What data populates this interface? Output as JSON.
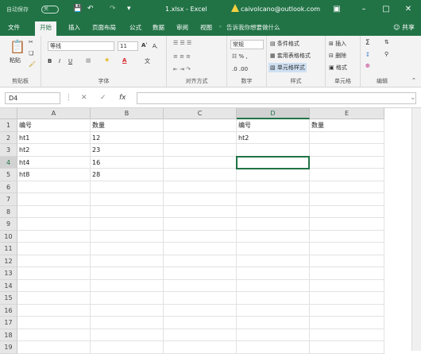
{
  "titlebar": {
    "autosave": "自动保存",
    "toggle": "关",
    "filename": "1.xlsx - Excel",
    "account": "caivolcano@outlook.com"
  },
  "tabs": [
    "文件",
    "开始",
    "插入",
    "页面布局",
    "公式",
    "数据",
    "审阅",
    "视图"
  ],
  "tellme": "告诉我你想要做什么",
  "share": "共享",
  "ribbon": {
    "clipboard": {
      "paste": "粘贴",
      "label": "剪贴板"
    },
    "font": {
      "name": "等线",
      "size": "11",
      "label": "字体"
    },
    "alignment": {
      "label": "对齐方式"
    },
    "number": {
      "format": "常规",
      "label": "数字"
    },
    "styles": {
      "conditional": "条件格式",
      "table": "套用表格格式",
      "cell": "单元格样式",
      "label": "样式"
    },
    "cells": {
      "insert": "插入",
      "delete": "删除",
      "format": "格式",
      "label": "单元格"
    },
    "editing": {
      "label": "编辑"
    }
  },
  "formula": {
    "namebox": "D4",
    "fx": "fx"
  },
  "columns": [
    "A",
    "B",
    "C",
    "D",
    "E"
  ],
  "rows": [
    "1",
    "2",
    "3",
    "4",
    "5",
    "6",
    "7",
    "8",
    "9",
    "10",
    "11",
    "12",
    "13",
    "14",
    "15",
    "16",
    "17",
    "18",
    "19"
  ],
  "cells": {
    "A1": "编号",
    "B1": "数量",
    "A2": "ht1",
    "B2": "12",
    "A3": "ht2",
    "B3": "23",
    "A4": "ht4",
    "B4": "16",
    "A5": "ht8",
    "B5": "28",
    "D1": "编号",
    "E1": "数量",
    "D2": "ht2"
  }
}
